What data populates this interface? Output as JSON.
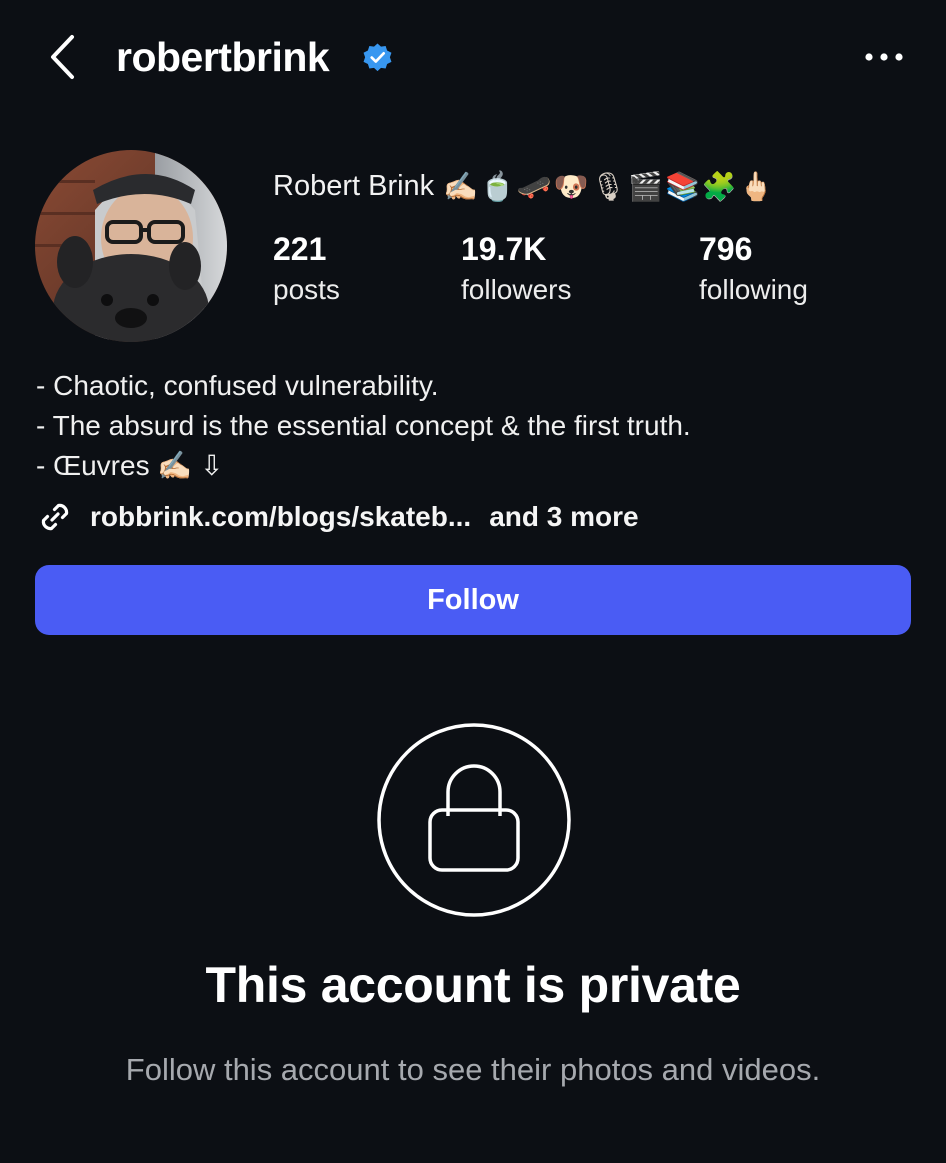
{
  "header": {
    "username": "robertbrink",
    "verified": true,
    "back_icon": "chevron-left-icon",
    "more_icon": "more-horizontal-icon"
  },
  "profile": {
    "display_name": "Robert Brink",
    "name_emojis": "✍🏻🍵🛹🐶🎙🎬📚🧩🖕🏻",
    "stats": [
      {
        "value": "221",
        "label": "posts"
      },
      {
        "value": "19.7K",
        "label": "followers"
      },
      {
        "value": "796",
        "label": "following"
      }
    ],
    "bio_lines": [
      "- Chaotic, confused vulnerability.",
      "- The absurd is the essential concept & the first truth.",
      "- Œuvres ✍🏻 ⇩"
    ],
    "link": {
      "text": "robbrink.com/blogs/skateb...",
      "more": "and 3 more"
    }
  },
  "actions": {
    "follow_label": "Follow"
  },
  "private_notice": {
    "title": "This account is private",
    "subtitle": "Follow this account to see their photos and videos."
  },
  "colors": {
    "background": "#0c0f14",
    "follow_button": "#4a5cf4",
    "verified_badge": "#3897f0",
    "subtitle_text": "#a6a9ae"
  }
}
